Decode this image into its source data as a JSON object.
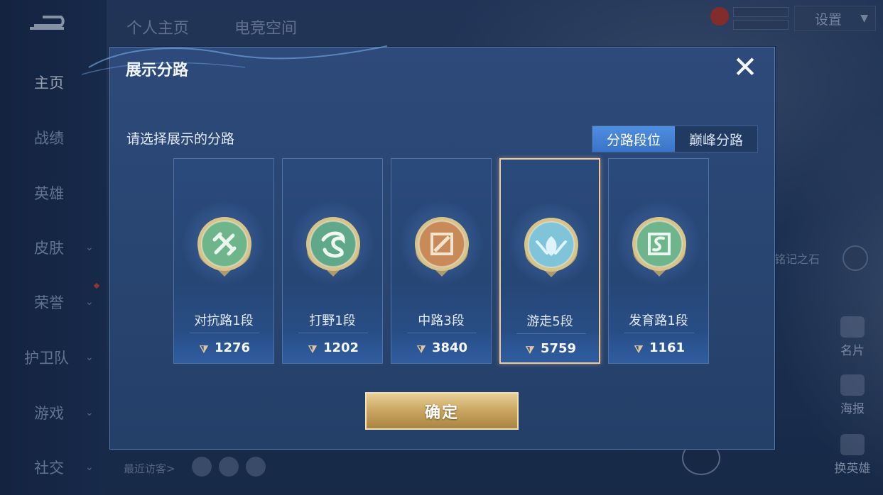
{
  "background": {
    "top_tabs": [
      "个人主页",
      "电竞空间"
    ],
    "settings_label": "设置",
    "sidebar": [
      {
        "label": "主页",
        "has_chevron": false,
        "active": true
      },
      {
        "label": "战绩",
        "has_chevron": false
      },
      {
        "label": "英雄",
        "has_chevron": false
      },
      {
        "label": "皮肤",
        "has_chevron": true
      },
      {
        "label": "荣誉",
        "has_chevron": true
      },
      {
        "label": "护卫队",
        "has_chevron": true
      },
      {
        "label": "游戏",
        "has_chevron": true
      },
      {
        "label": "社交",
        "has_chevron": true
      }
    ],
    "right_items": [
      "名片",
      "海报",
      "换英雄"
    ],
    "stone_label": "铭记之石",
    "visitors_label": "最近访客>"
  },
  "modal": {
    "title": "展示分路",
    "subtitle": "请选择展示的分路",
    "segments": [
      {
        "label": "分路段位",
        "active": true
      },
      {
        "label": "巅峰分路",
        "active": false
      }
    ],
    "cards": [
      {
        "name": "对抗路1段",
        "points": "1276",
        "selected": false,
        "badge_color": "#6fb58c",
        "badge_icon": "swords-icon"
      },
      {
        "name": "打野1段",
        "points": "1202",
        "selected": false,
        "badge_color": "#5fa88a",
        "badge_icon": "dragon-icon"
      },
      {
        "name": "中路3段",
        "points": "3840",
        "selected": false,
        "badge_color": "#c88a58",
        "badge_icon": "slash-icon"
      },
      {
        "name": "游走5段",
        "points": "5759",
        "selected": true,
        "badge_color": "#7fc4d8",
        "badge_icon": "wings-icon"
      },
      {
        "name": "发育路1段",
        "points": "1161",
        "selected": false,
        "badge_color": "#6fb58c",
        "badge_icon": "target-icon"
      }
    ],
    "confirm_label": "确定"
  }
}
